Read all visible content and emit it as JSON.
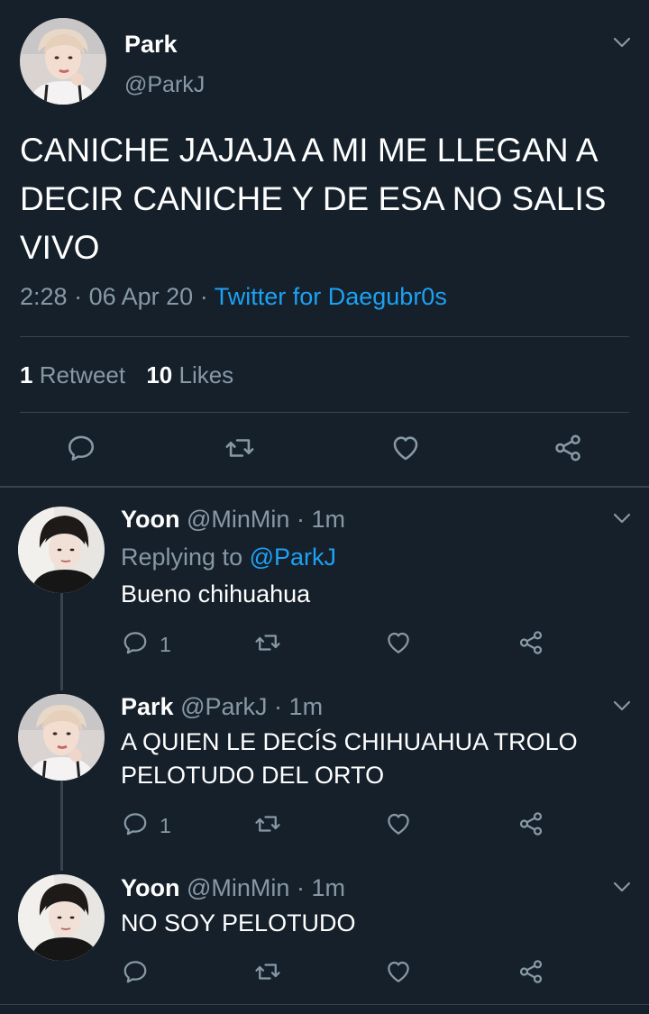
{
  "main_tweet": {
    "display_name": "Park",
    "handle": "@ParkJ",
    "text": "CANICHE JAJAJA A MI ME LLEGAN A DECIR CANICHE Y DE ESA NO SALIS VIVO",
    "time": "2:28",
    "sep1": "·",
    "date": "06 Apr 20",
    "sep2": "·",
    "source": "Twitter for Daegubr0s",
    "retweet_count": "1",
    "retweet_label": "Retweet",
    "like_count": "10",
    "like_label": "Likes"
  },
  "replies": [
    {
      "display_name": "Yoon",
      "handle": "@MinMin",
      "sep": "·",
      "time": "1m",
      "replying_prefix": "Replying to",
      "replying_to": "@ParkJ",
      "text": "Bueno chihuahua",
      "reply_count": "1"
    },
    {
      "display_name": "Park",
      "handle": "@ParkJ",
      "sep": "·",
      "time": "1m",
      "text_line1": "A QUIEN LE DECÍS CHIHUAHUA TROLO",
      "text_line2": "PELOTUDO DEL ORTO",
      "reply_count": "1"
    },
    {
      "display_name": "Yoon",
      "handle": "@MinMin",
      "sep": "·",
      "time": "1m",
      "text": "NO SOY PELOTUDO"
    }
  ],
  "colors": {
    "background": "#15202b",
    "accent": "#1da1f2",
    "muted": "#8899a6",
    "divider": "#38444d"
  },
  "icons": {
    "reply": "speech-bubble-icon",
    "retweet": "retweet-icon",
    "like": "heart-icon",
    "share": "share-icon",
    "menu": "chevron-down-icon"
  }
}
